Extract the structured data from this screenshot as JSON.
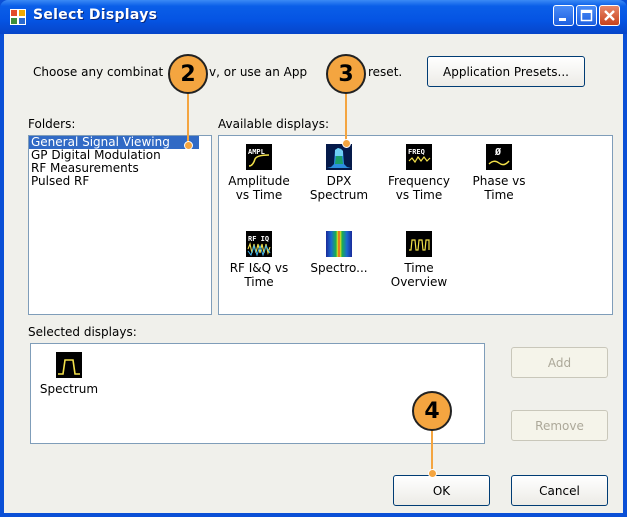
{
  "window": {
    "title": "Select Displays"
  },
  "instructions": {
    "part1": "Choose any combinat",
    "part2": "v, or use an App",
    "part3": "reset."
  },
  "buttons": {
    "application_presets": "Application Presets...",
    "add": "Add",
    "remove": "Remove",
    "ok": "OK",
    "cancel": "Cancel"
  },
  "folders": {
    "label": "Folders:",
    "items": [
      "General Signal Viewing",
      "GP Digital Modulation",
      "RF Measurements",
      "Pulsed RF"
    ],
    "selected": "General Signal Viewing"
  },
  "available": {
    "label": "Available displays:",
    "items": [
      {
        "line1": "Amplitude",
        "line2": "vs Time",
        "icon": "ampl-icon",
        "icon_text": "AMPL"
      },
      {
        "line1": "DPX",
        "line2": "Spectrum",
        "icon": "dpx-icon",
        "icon_text": ""
      },
      {
        "line1": "Frequency",
        "line2": "vs Time",
        "icon": "freq-icon",
        "icon_text": "FREQ"
      },
      {
        "line1": "Phase vs",
        "line2": "Time",
        "icon": "phase-icon",
        "icon_text": "Ø"
      },
      {
        "line1": "RF I&Q vs",
        "line2": "Time",
        "icon": "rfiq-icon",
        "icon_text": "RF IQ"
      },
      {
        "line1": "Spectro...",
        "line2": "",
        "icon": "spectrogram-icon",
        "icon_text": ""
      },
      {
        "line1": "Time",
        "line2": "Overview",
        "icon": "time-overview-icon",
        "icon_text": ""
      }
    ]
  },
  "selected": {
    "label": "Selected displays:",
    "items": [
      {
        "label": "Spectrum",
        "icon": "spectrum-icon"
      }
    ]
  },
  "callouts": [
    "2",
    "3",
    "4"
  ],
  "colors": {
    "callout": "#f4a540",
    "title_bar": "#0a5ee8",
    "selection": "#316ac5"
  }
}
